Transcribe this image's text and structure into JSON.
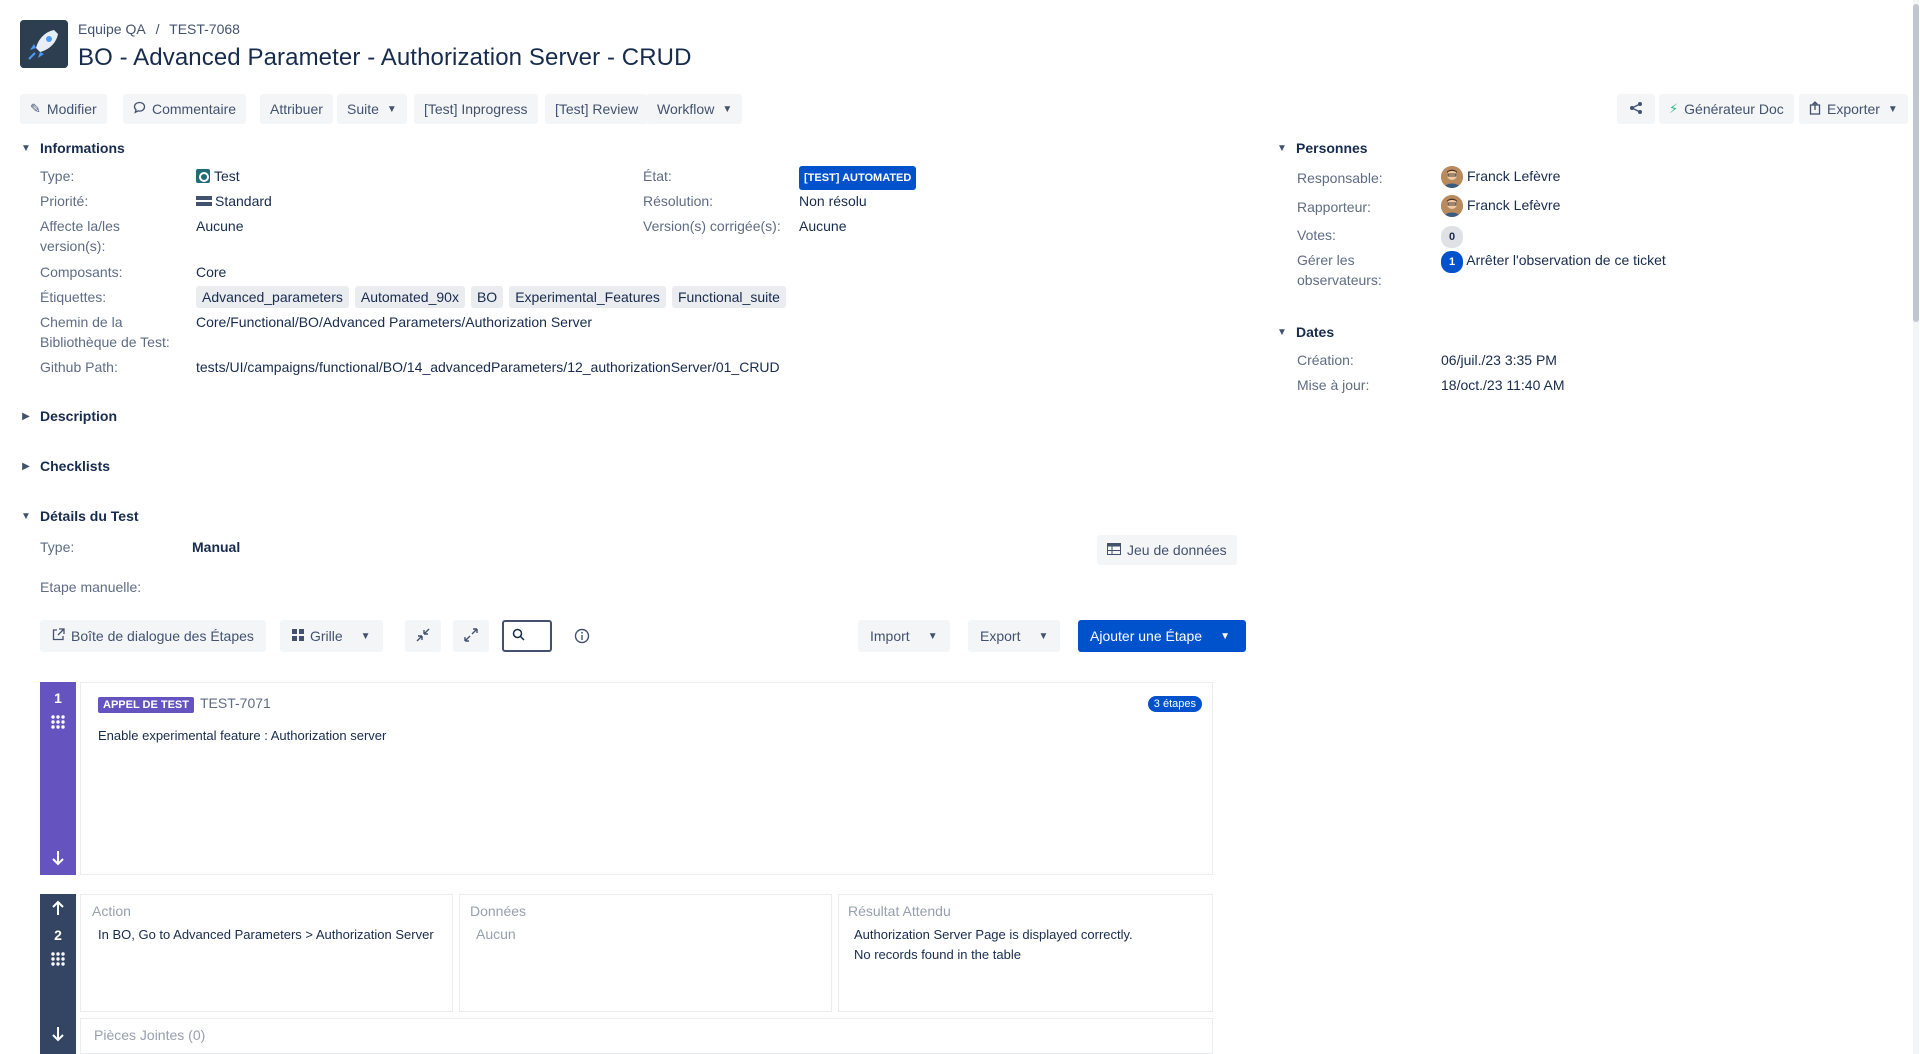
{
  "header": {
    "breadcrumb_project": "Equipe QA",
    "breadcrumb_sep": "/",
    "breadcrumb_issue": "TEST-7068",
    "title": "BO - Advanced Parameter - Authorization Server - CRUD"
  },
  "toolbar": {
    "edit": "Modifier",
    "comment": "Commentaire",
    "assign": "Attribuer",
    "more": "Suite",
    "inprogress": "[Test] Inprogress",
    "review": "[Test] Review",
    "workflow": "Workflow",
    "doc_generator": "Générateur Doc",
    "export": "Exporter"
  },
  "informations": {
    "heading": "Informations",
    "type_label": "Type:",
    "type_value": "Test",
    "priority_label": "Priorité:",
    "priority_value": "Standard",
    "affects_label_1": "Affecte la/les",
    "affects_label_2": "version(s):",
    "affects_value": "Aucune",
    "components_label": "Composants:",
    "components_value": "Core",
    "labels_label": "Étiquettes:",
    "labels": [
      "Advanced_parameters",
      "Automated_90x",
      "BO",
      "Experimental_Features",
      "Functional_suite"
    ],
    "path_label_1": "Chemin de la",
    "path_label_2": "Bibliothèque de Test:",
    "path_value": "Core/Functional/BO/Advanced Parameters/Authorization Server",
    "github_label": "Github Path:",
    "github_value": "tests/UI/campaigns/functional/BO/14_advancedParameters/12_authorizationServer/01_CRUD",
    "status_label": "État:",
    "status_value": "[TEST] AUTOMATED",
    "resolution_label": "Résolution:",
    "resolution_value": "Non résolu",
    "fix_versions_label": "Version(s) corrigée(s):",
    "fix_versions_value": "Aucune"
  },
  "people": {
    "heading": "Personnes",
    "assignee_label": "Responsable:",
    "assignee_value": "Franck Lefèvre",
    "reporter_label": "Rapporteur:",
    "reporter_value": "Franck Lefèvre",
    "votes_label": "Votes:",
    "votes_value": "0",
    "watchers_label_1": "Gérer les",
    "watchers_label_2": "observateurs:",
    "watchers_count": "1",
    "watchers_action": "Arrêter l'observation de ce ticket"
  },
  "dates": {
    "heading": "Dates",
    "created_label": "Création:",
    "created_value": "06/juil./23 3:35 PM",
    "updated_label": "Mise à jour:",
    "updated_value": "18/oct./23 11:40 AM"
  },
  "sections": {
    "description": "Description",
    "checklists": "Checklists",
    "test_details": "Détails du Test"
  },
  "test_details": {
    "type_label": "Type:",
    "type_value": "Manual",
    "dataset_button": "Jeu de données",
    "manual_step_label": "Etape manuelle:",
    "steps_dialog": "Boîte de dialogue des Étapes",
    "grid": "Grille",
    "import": "Import",
    "export": "Export",
    "add_step": "Ajouter une Étape"
  },
  "steps": [
    {
      "number": "1",
      "call_badge": "APPEL DE TEST",
      "call_key": "TEST-7071",
      "steps_badge": "3 étapes",
      "text": "Enable experimental feature : Authorization server"
    },
    {
      "number": "2",
      "action_head": "Action",
      "data_head": "Données",
      "result_head": "Résultat Attendu",
      "action": "In BO, Go to Advanced Parameters > Authorization Server",
      "data": "Aucun",
      "result_1": "Authorization Server Page is displayed correctly.",
      "result_2": "No records found in the table",
      "attachments": "Pièces Jointes (0)"
    }
  ],
  "colors": {
    "accent": "#0052cc",
    "step_call": "#6554c0",
    "step_normal": "#344563"
  }
}
